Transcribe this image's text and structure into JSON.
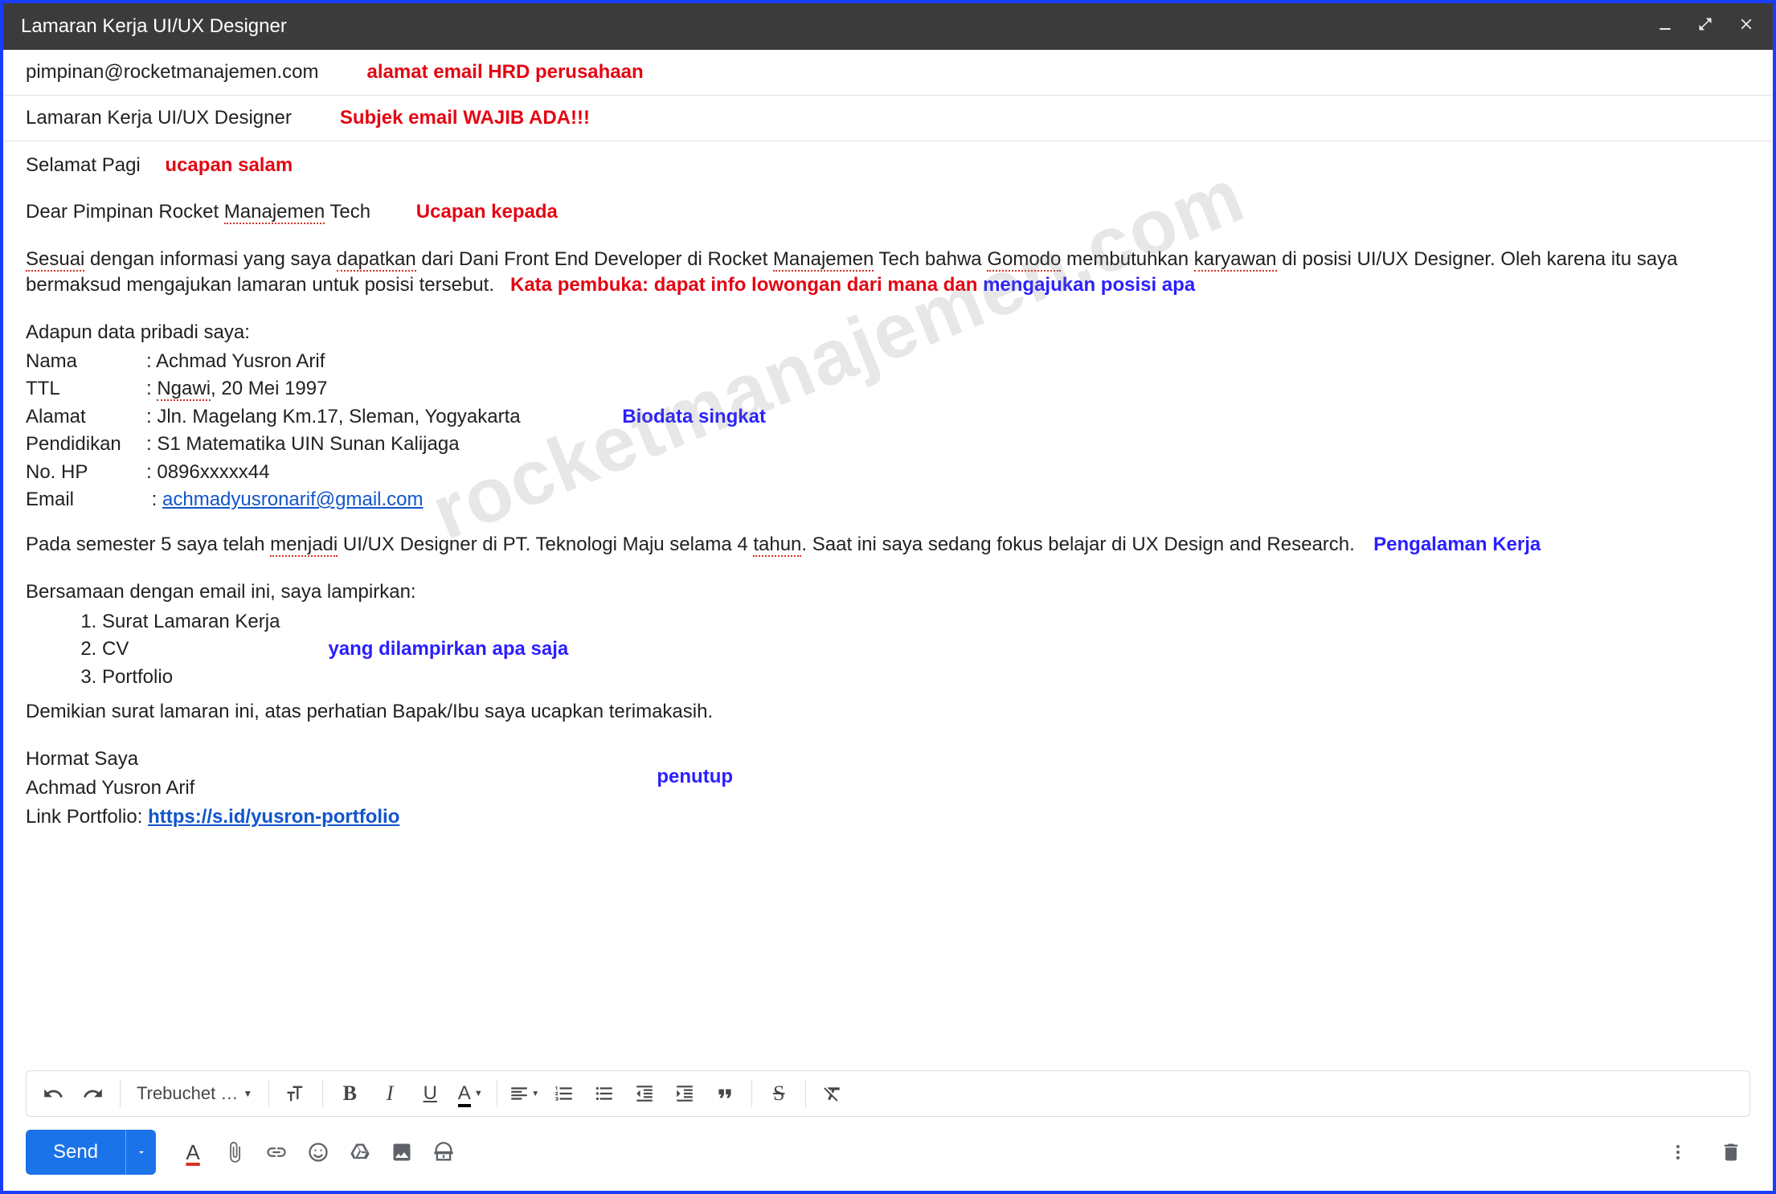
{
  "header": {
    "title": "Lamaran Kerja UI/UX Designer"
  },
  "fields": {
    "to": "pimpinan@rocketmanajemen.com",
    "subject": "Lamaran Kerja UI/UX Designer"
  },
  "annotations": {
    "to": "alamat email HRD perusahaan",
    "subject": "Subjek email WAJIB ADA!!!",
    "greeting": "ucapan salam",
    "salutation": "Ucapan kepada",
    "opening": "Kata pembuka: dapat info lowongan dari mana dan",
    "opening_blue": "mengajukan posisi apa",
    "biodata": "Biodata singkat",
    "experience": "Pengalaman Kerja",
    "attachments": "yang dilampirkan apa saja",
    "closing": "penutup"
  },
  "body": {
    "greeting": "Selamat Pagi",
    "salutation_pre": "Dear Pimpinan Rocket ",
    "salutation_sp": "Manajemen",
    "salutation_post": " Tech",
    "opening_1a": "Sesuai",
    "opening_1b": " dengan informasi yang saya ",
    "opening_1c": "dapatkan",
    "opening_1d": " dari Dani Front End Developer di Rocket ",
    "opening_1e": "Manajemen",
    "opening_1f": " Tech bahwa ",
    "opening_1g": "Gomodo",
    "opening_1h": " membutuhkan ",
    "opening_1i": "karyawan",
    "opening_1j": " di posisi UI/UX Designer. Oleh karena itu saya bermaksud mengajukan lamaran untuk posisi tersebut.",
    "bio_intro": "Adapun data pribadi saya:",
    "bio": {
      "nama_l": "Nama",
      "nama_v": "Achmad Yusron Arif",
      "ttl_l": "TTL",
      "ttl_sp": "Ngawi",
      "ttl_v2": ", 20 Mei 1997",
      "alamat_l": "Alamat",
      "alamat_v": "Jln. Magelang Km.17, Sleman, Yogyakarta",
      "pend_l": "Pendidikan",
      "pend_v": "S1 Matematika UIN Sunan Kalijaga",
      "hp_l": "No. HP",
      "hp_v": "0896xxxxx44",
      "email_l": "Email",
      "email_v": "achmadyusronarif@gmail.com"
    },
    "exp_a": "Pada semester 5 saya telah ",
    "exp_sp1": "menjadi",
    "exp_b": " UI/UX Designer di PT. Teknologi Maju selama 4 ",
    "exp_sp2": "tahun",
    "exp_c": ". Saat ini saya sedang fokus belajar di UX Design and Research.",
    "attach_intro": "Bersamaan dengan email ini, saya lampirkan:",
    "attachments": [
      "Surat Lamaran Kerja",
      "CV",
      "Portfolio"
    ],
    "closing_line": "Demikian surat lamaran ini, atas perhatian Bapak/Ibu saya ucapkan terimakasih.",
    "hormat": "Hormat Saya",
    "nama_ttd": "Achmad Yusron Arif",
    "portfolio_label": "Link Portfolio: ",
    "portfolio_link": "https://s.id/yusron-portfolio"
  },
  "watermark": "rocketmanajemen.com",
  "toolbar": {
    "font_label": "Trebuchet …",
    "send_label": "Send"
  }
}
